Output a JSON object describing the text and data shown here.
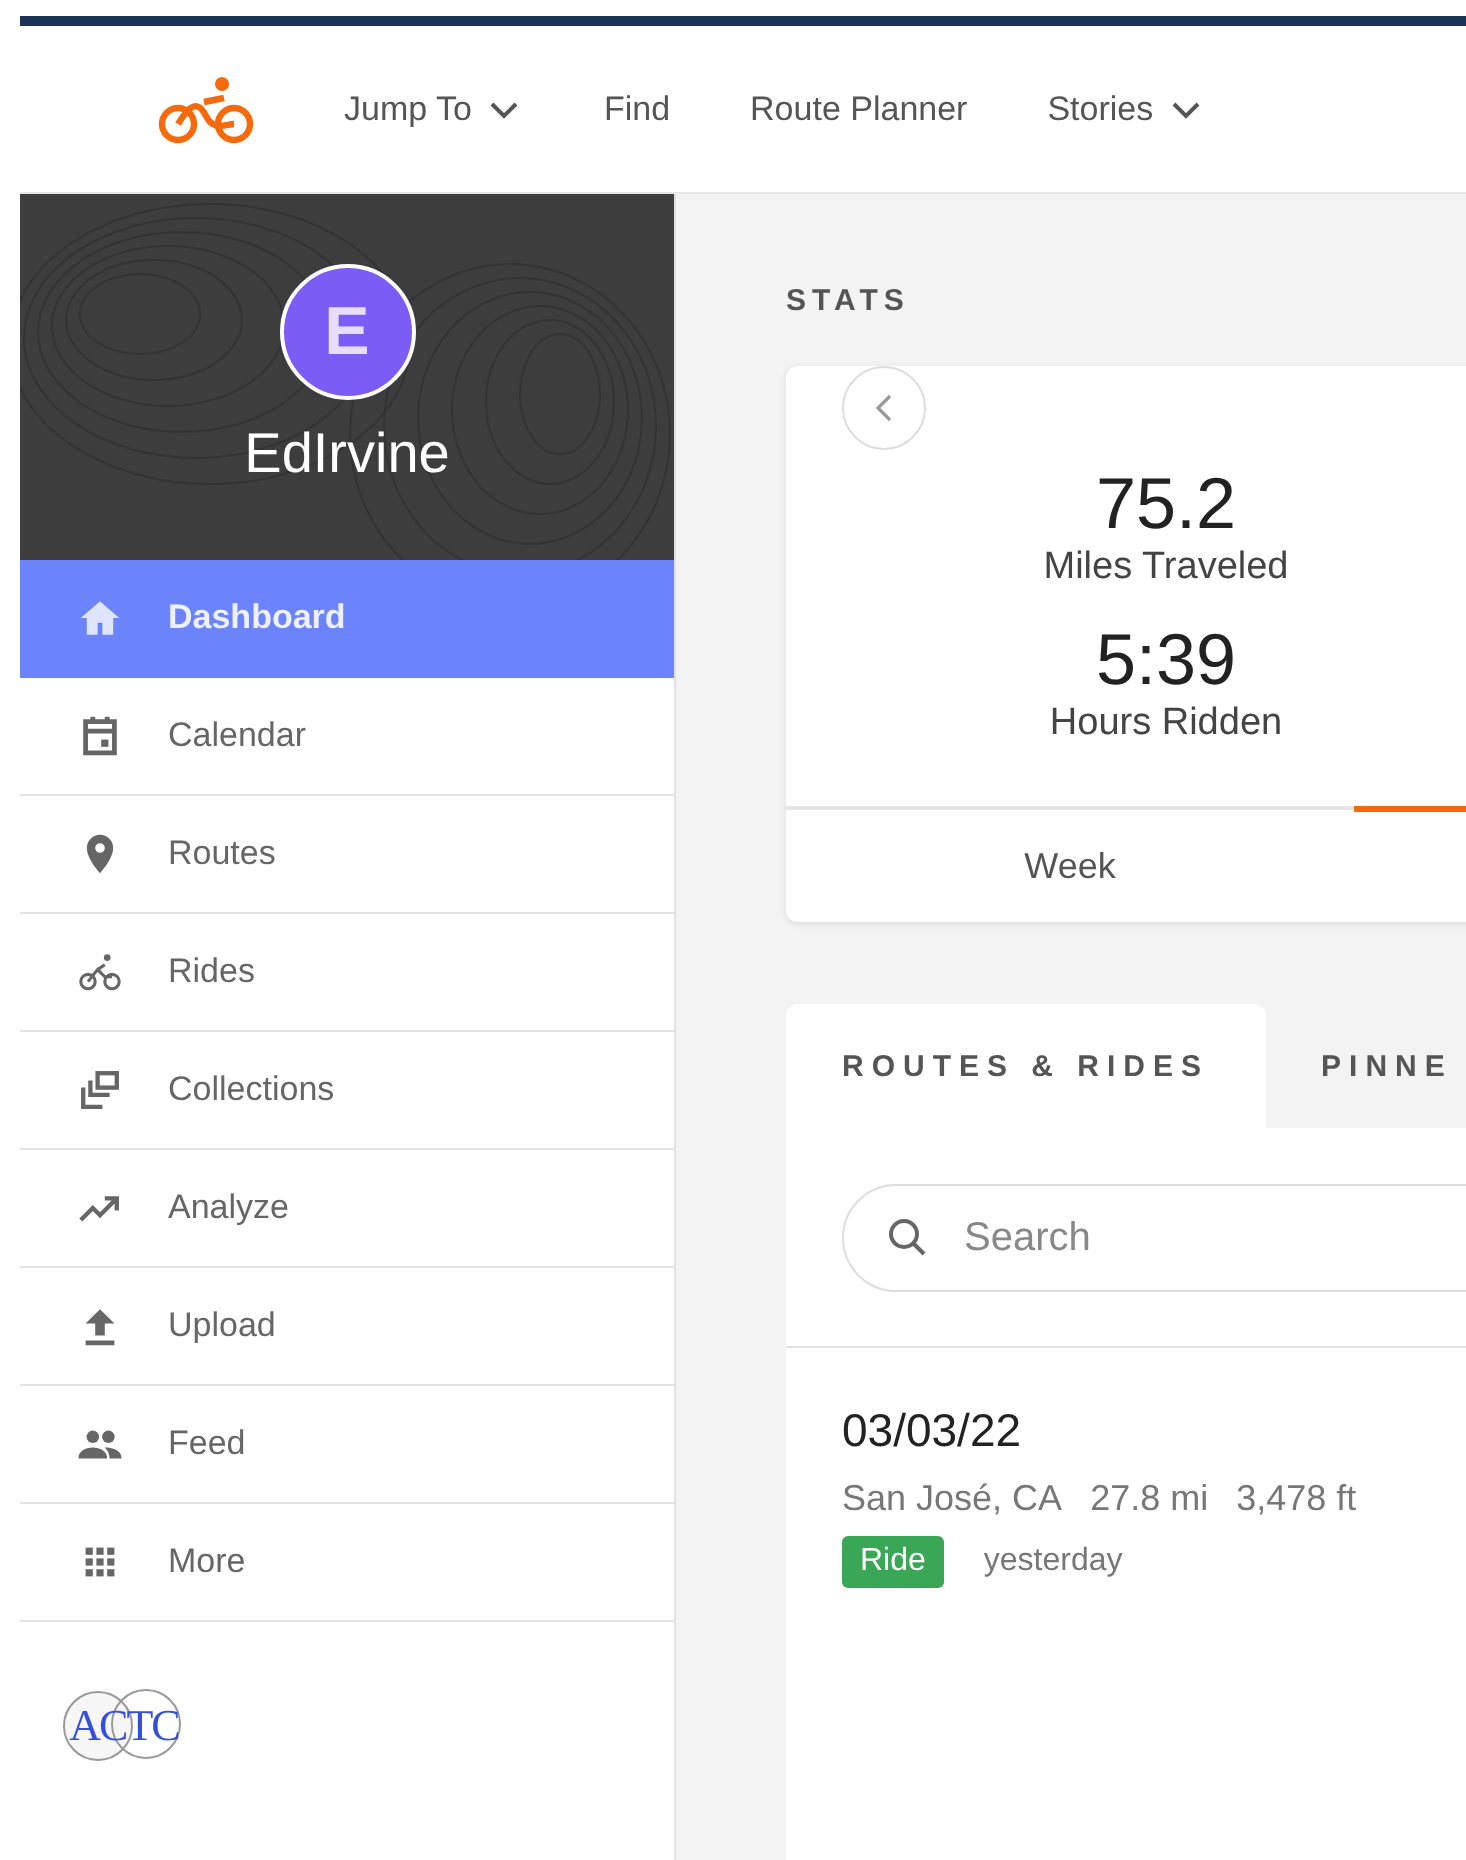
{
  "header": {
    "nav": [
      {
        "label": "Jump To",
        "dropdown": true
      },
      {
        "label": "Find",
        "dropdown": false
      },
      {
        "label": "Route Planner",
        "dropdown": false
      },
      {
        "label": "Stories",
        "dropdown": true
      }
    ]
  },
  "sidebar": {
    "avatar_letter": "E",
    "username": "EdIrvine",
    "items": [
      {
        "label": "Dashboard",
        "selected": true
      },
      {
        "label": "Calendar",
        "selected": false
      },
      {
        "label": "Routes",
        "selected": false
      },
      {
        "label": "Rides",
        "selected": false
      },
      {
        "label": "Collections",
        "selected": false
      },
      {
        "label": "Analyze",
        "selected": false
      },
      {
        "label": "Upload",
        "selected": false
      },
      {
        "label": "Feed",
        "selected": false
      },
      {
        "label": "More",
        "selected": false
      }
    ],
    "club_logo": "ACTC"
  },
  "stats": {
    "heading": "STATS",
    "values": [
      {
        "value": "75.2",
        "label": "Miles Traveled"
      },
      {
        "value": "5:39",
        "label": "Hours Ridden"
      }
    ],
    "period_tabs": [
      {
        "label": "Week",
        "selected": false
      },
      {
        "selected": true
      }
    ]
  },
  "routes_panel": {
    "tabs": [
      {
        "label": "ROUTES & RIDES",
        "selected": true
      },
      {
        "label": "PINNE",
        "selected": false
      }
    ],
    "search": {
      "placeholder": "Search"
    },
    "entries": [
      {
        "date": "03/03/22",
        "location": "San José, CA",
        "distance": "27.8 mi",
        "elevation": "3,478 ft",
        "tag": "Ride",
        "color": "#3aa757",
        "when": "yesterday"
      }
    ]
  }
}
